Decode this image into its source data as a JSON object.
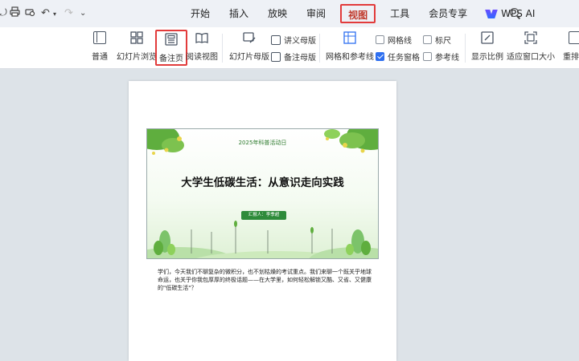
{
  "ribbon_tabs": [
    {
      "label": "开始"
    },
    {
      "label": "插入"
    },
    {
      "label": "放映"
    },
    {
      "label": "审阅"
    },
    {
      "label": "视图",
      "active": true
    },
    {
      "label": "工具"
    },
    {
      "label": "会员专享"
    }
  ],
  "ai_tab": {
    "label": "WPS AI"
  },
  "ribbon": {
    "normal": "普通",
    "slide_sorter": "幻灯片浏览",
    "notes_page": "备注页",
    "reading_view": "阅读视图",
    "slide_master": "幻灯片母版",
    "handout_master": "讲义母版",
    "notes_master": "备注母版",
    "grid_guides": "网格和参考线",
    "gridlines": "网格线",
    "task_pane": "任务窗格",
    "ruler": "标尺",
    "guides": "参考线",
    "zoom": "显示比例",
    "fit_window": "适应窗口大小",
    "rearrange": "重排窗"
  },
  "checkboxes": {
    "gridlines": false,
    "task_pane": true,
    "ruler": false,
    "guides": false
  },
  "slide": {
    "subtitle": "2025年科普活动日",
    "title": "大学生低碳生活：从意识走向实践",
    "presenter": "汇报人：李季超"
  },
  "notes": "学们，今天我们不聊复杂的微积分，也不划枯燥的考试重点。我们来聊一个既关乎地球命运，也关乎你我包厚厚的终极话题——在大学里，如何轻松解锁又酷、又省、又健康的\"低碳生活\"？",
  "colors": {
    "accent_red": "#e23b3b",
    "brand_green": "#2e8b3a",
    "checkbox_blue": "#2e6ff0"
  }
}
